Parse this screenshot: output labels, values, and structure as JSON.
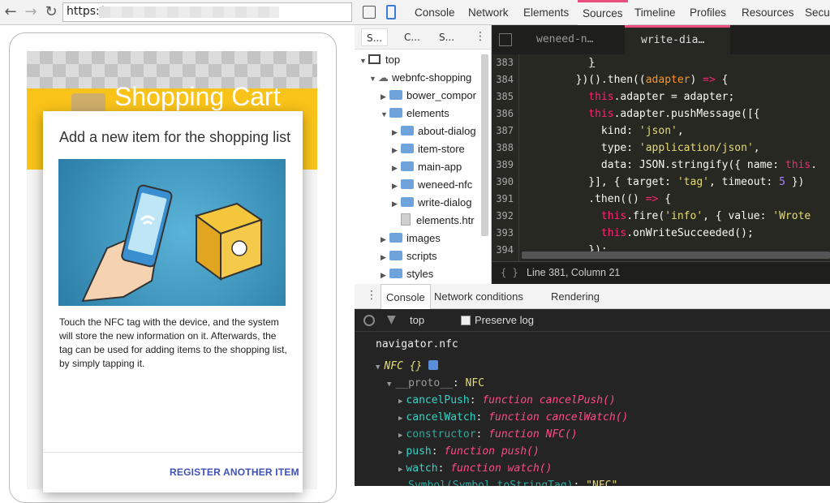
{
  "browser": {
    "url": "https:/"
  },
  "app": {
    "title": "Shopping Cart",
    "dialog": {
      "title": "Add a new item for the shopping list",
      "body": "Touch the NFC tag with the device, and the system will store the new information on it. Afterwards, the tag can be used for adding items to the shopping list, by simply tapping it.",
      "button": "REGISTER ANOTHER ITEM"
    }
  },
  "devtools": {
    "tabs": [
      "Console",
      "Network",
      "Elements",
      "Sources",
      "Timeline",
      "Profiles",
      "Resources",
      "Secur"
    ],
    "active_tab": "Sources",
    "navigator": {
      "tabs": [
        "S...",
        "C...",
        "S..."
      ],
      "tree": [
        {
          "label": "top",
          "kind": "frame"
        },
        {
          "label": "webnfc-shopping",
          "kind": "domain"
        },
        {
          "label": "bower_compor",
          "kind": "folder"
        },
        {
          "label": "elements",
          "kind": "folder"
        },
        {
          "label": "about-dialog",
          "kind": "folder"
        },
        {
          "label": "item-store",
          "kind": "folder"
        },
        {
          "label": "main-app",
          "kind": "folder"
        },
        {
          "label": "weneed-nfc",
          "kind": "folder"
        },
        {
          "label": "write-dialog",
          "kind": "folder"
        },
        {
          "label": "elements.htr",
          "kind": "file"
        },
        {
          "label": "images",
          "kind": "folder"
        },
        {
          "label": "scripts",
          "kind": "folder"
        },
        {
          "label": "styles",
          "kind": "folder"
        }
      ]
    },
    "editor": {
      "tabs": [
        "weneed-n…",
        "write-dia…"
      ],
      "line_numbers": [
        "383",
        "384",
        "385",
        "386",
        "387",
        "388",
        "389",
        "390",
        "391",
        "392",
        "393",
        "394"
      ],
      "status": "Line 381, Column 21",
      "status_icon": "{ }"
    },
    "drawer": {
      "tabs": [
        "Console",
        "Network conditions",
        "Rendering"
      ],
      "context": "top",
      "preserve_log": "Preserve log",
      "input": "navigator.nfc",
      "object": "NFC {}",
      "proto_key": "__proto__",
      "proto_val": "NFC",
      "props": [
        {
          "key": "cancelPush",
          "val": "function cancelPush()"
        },
        {
          "key": "cancelWatch",
          "val": "function cancelWatch()"
        },
        {
          "key": "constructor",
          "val": "function NFC()"
        },
        {
          "key": "push",
          "val": "function push()"
        },
        {
          "key": "watch",
          "val": "function watch()"
        }
      ],
      "last_key": "Symbol(Symbol.toStringTag)",
      "last_val": "\"NFC\""
    }
  }
}
